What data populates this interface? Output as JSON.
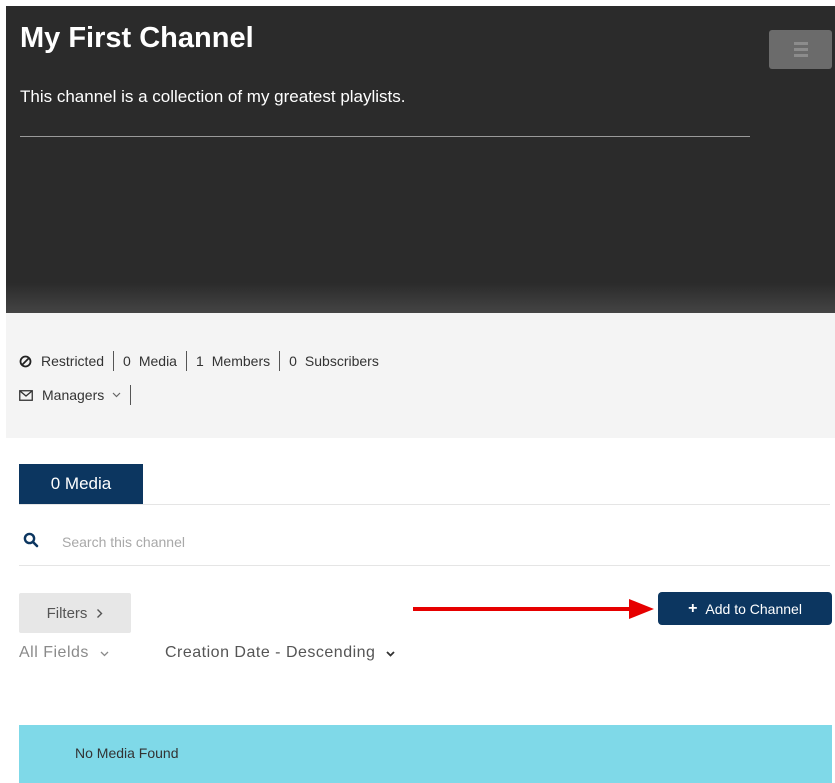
{
  "channel": {
    "title": "My First Channel",
    "description": "This channel is a collection of my greatest playlists."
  },
  "info": {
    "restricted_label": "Restricted",
    "media_count": "0",
    "media_label": "Media",
    "members_count": "1",
    "members_label": "Members",
    "subscribers_count": "0",
    "subscribers_label": "Subscribers",
    "managers_label": "Managers"
  },
  "tabs": [
    {
      "label": "0 Media"
    }
  ],
  "search": {
    "placeholder": "Search this channel"
  },
  "toolbar": {
    "filters_label": "Filters",
    "add_label": "Add to Channel"
  },
  "sort": {
    "field_label": "All Fields",
    "order_label": "Creation Date - Descending"
  },
  "results": {
    "empty_message": "No Media Found"
  },
  "colors": {
    "header_bg": "#2b2b2b",
    "accent_navy": "#0c3660",
    "annotation_arrow": "#e60000",
    "empty_banner": "#7fd9e8"
  },
  "icons": {
    "restricted": "ban-circle-icon",
    "managers": "envelope-icon",
    "search": "search-icon",
    "menu": "menu-icon"
  }
}
